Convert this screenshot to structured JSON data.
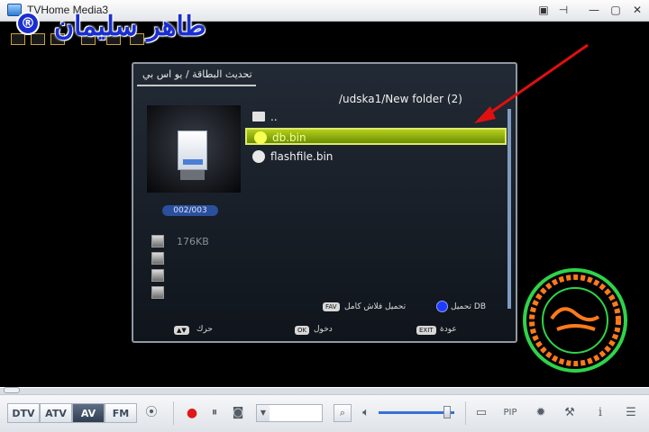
{
  "window": {
    "title": "TVHome Media3",
    "buttons": [
      "▣",
      "⊣",
      "—",
      "▢",
      "✕"
    ]
  },
  "watermark": {
    "name": "طاهر سليمان",
    "symbol": "®"
  },
  "stb": {
    "title": "تحديث البطاقة / يو اس بي",
    "path": "/udska1/New folder (2)",
    "files": [
      {
        "name": "..",
        "type": "folder"
      },
      {
        "name": "db.bin",
        "type": "file",
        "selected": true
      },
      {
        "name": "flashfile.bin",
        "type": "file"
      }
    ],
    "counter": "002/003",
    "file_size": "176KB",
    "key_hints": [
      {
        "key": "FAV",
        "label": "تحميل فلاش كامل"
      },
      {
        "key": "",
        "label": "تحميل DB"
      },
      {
        "key": "▲▼",
        "label": "حرك"
      },
      {
        "key": "OK",
        "label": "دخول"
      },
      {
        "key": "EXIT",
        "label": "عودة"
      }
    ]
  },
  "controls": {
    "sources": [
      {
        "label": "DTV",
        "active": false
      },
      {
        "label": "ATV",
        "active": false
      },
      {
        "label": "AV",
        "active": true
      },
      {
        "label": "FM",
        "active": false
      }
    ],
    "icons": [
      "play-icon",
      "record-icon",
      "pause-icon",
      "camera-icon",
      "search-icon",
      "volume-icon",
      "monitor-icon",
      "pip-icon",
      "settings-icon",
      "tools-icon",
      "info-icon",
      "list-icon"
    ],
    "pip_label": "PIP",
    "info_label": "i",
    "volume_level": 0.9,
    "accent": "#3572d6"
  },
  "colors": {
    "highlight": "#9dbb12",
    "arrow": "#e01010"
  }
}
